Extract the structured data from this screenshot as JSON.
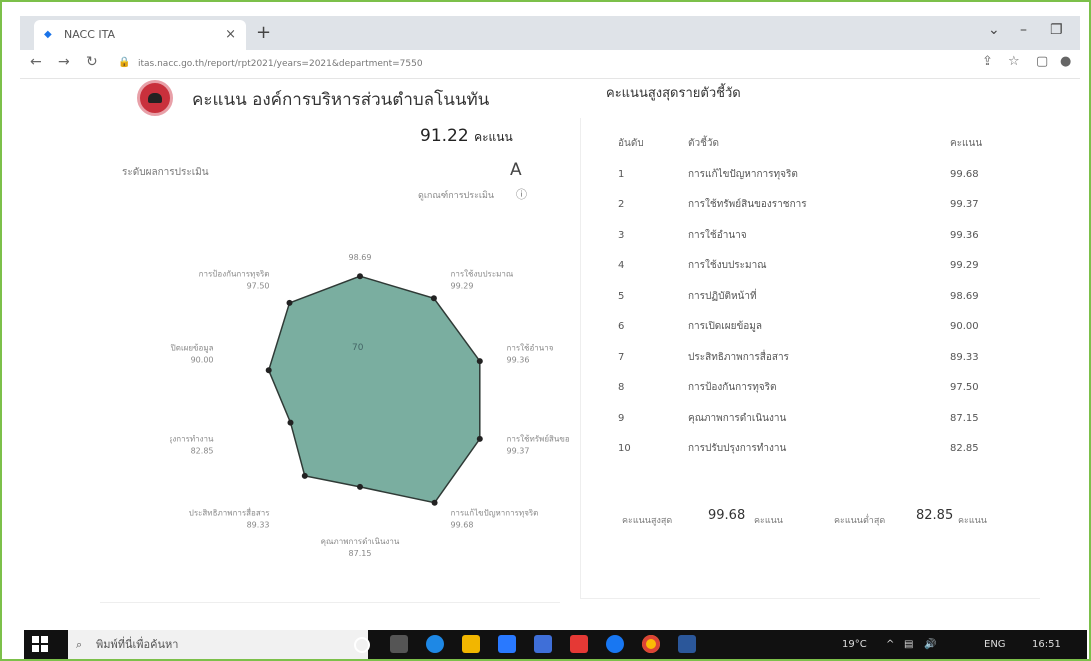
{
  "browser": {
    "tab_title": "NACC ITA",
    "url": "itas.nacc.go.th/report/rpt2021/years=2021&department=7550"
  },
  "org": {
    "title": "คะแนน องค์การบริหารส่วนตำบลโนนทัน",
    "score": "91.22",
    "score_unit": "คะแนน",
    "level_label": "ระดับผลการประเมิน",
    "level": "A",
    "note": "ดูเกณฑ์การประเมิน"
  },
  "radar": {
    "center_top_label": "70",
    "axes": [
      {
        "label": "การปฏิบัติหน้าที่",
        "value": "98.69"
      },
      {
        "label": "การใช้งบประมาณ",
        "value": "99.29"
      },
      {
        "label": "การใช้อำนาจ",
        "value": "99.36"
      },
      {
        "label": "การใช้ทรัพย์สินของราชการ",
        "value": "99.37"
      },
      {
        "label": "การแก้ไขปัญหาการทุจริต",
        "value": "99.68"
      },
      {
        "label": "คุณภาพการดำเนินงาน",
        "value": "87.15"
      },
      {
        "label": "ประสิทธิภาพการสื่อสาร",
        "value": "89.33"
      },
      {
        "label": "การปรับปรุงการทำงาน",
        "value": "82.85"
      },
      {
        "label": "การเปิดเผยข้อมูล",
        "value": "90.00"
      },
      {
        "label": "การป้องกันการทุจริต",
        "value": "97.50"
      }
    ]
  },
  "ranking": {
    "title": "คะแนนสูงสุดรายตัวชี้วัด",
    "headers": {
      "rank": "อันดับ",
      "indicator": "ตัวชี้วัด",
      "score": "คะแนน"
    },
    "rows": [
      {
        "rank": "1",
        "indicator": "การแก้ไขปัญหาการทุจริต",
        "score": "99.68"
      },
      {
        "rank": "2",
        "indicator": "การใช้ทรัพย์สินของราชการ",
        "score": "99.37"
      },
      {
        "rank": "3",
        "indicator": "การใช้อำนาจ",
        "score": "99.36"
      },
      {
        "rank": "4",
        "indicator": "การใช้งบประมาณ",
        "score": "99.29"
      },
      {
        "rank": "5",
        "indicator": "การปฏิบัติหน้าที่",
        "score": "98.69"
      },
      {
        "rank": "6",
        "indicator": "การเปิดเผยข้อมูล",
        "score": "90.00"
      },
      {
        "rank": "7",
        "indicator": "ประสิทธิภาพการสื่อสาร",
        "score": "89.33"
      },
      {
        "rank": "8",
        "indicator": "การป้องกันการทุจริต",
        "score": "97.50"
      },
      {
        "rank": "9",
        "indicator": "คุณภาพการดำเนินงาน",
        "score": "87.15"
      },
      {
        "rank": "10",
        "indicator": "การปรับปรุงการทำงาน",
        "score": "82.85"
      }
    ],
    "summary": {
      "max_label": "คะแนนสูงสุด",
      "max_value": "99.68",
      "max_unit": "คะแนน",
      "min_label": "คะแนนต่ำสุด",
      "min_value": "82.85",
      "min_unit": "คะแนน"
    }
  },
  "taskbar": {
    "search_placeholder": "พิมพ์ที่นี่เพื่อค้นหา",
    "tray_temp": "19°C",
    "tray_lang": "ENG",
    "tray_time": "16:51"
  },
  "colors": {
    "radar_fill": "#7aaea0",
    "frame": "#7cc04a"
  }
}
